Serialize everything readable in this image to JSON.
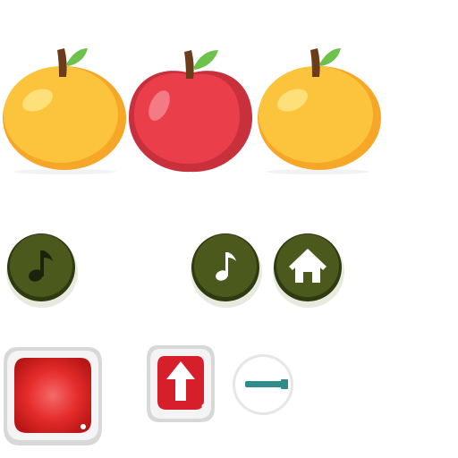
{
  "sprites": {
    "fruits": [
      {
        "name": "orange",
        "icon": "orange-icon",
        "body": "#fcc43c",
        "shade": "#f6a728",
        "highlight": "#fde07a"
      },
      {
        "name": "apple",
        "icon": "apple-icon",
        "body": "#ea3e4b",
        "shade": "#c8303c",
        "highlight": "#f47a84"
      },
      {
        "name": "orange",
        "icon": "orange-icon",
        "body": "#fcc43c",
        "shade": "#f6a728",
        "highlight": "#fde07a"
      }
    ],
    "stem_color": "#6b3b1a",
    "leaf_color": "#6cc24a"
  },
  "buttons": {
    "round_dark": {
      "face": "#4b5a1c",
      "rim": "#2e3a10",
      "light_rim": "#e8eadf",
      "items": [
        {
          "id": "music-dark",
          "icon": "music-note-icon",
          "glyph_color": "#1c230a"
        },
        {
          "id": "music-light",
          "icon": "music-note-icon",
          "glyph_color": "#ffffff"
        },
        {
          "id": "home",
          "icon": "home-icon",
          "glyph_color": "#ffffff"
        }
      ]
    },
    "red_square": {
      "face": "#e52b2b",
      "frame": "#eeeeee"
    },
    "upload": {
      "icon": "arrow-up-icon",
      "face": "#d61f2b",
      "arrow": "#ffffff"
    },
    "minus": {
      "icon": "minus-icon",
      "bar": "#2f8c8a",
      "face": "#ffffff"
    }
  }
}
